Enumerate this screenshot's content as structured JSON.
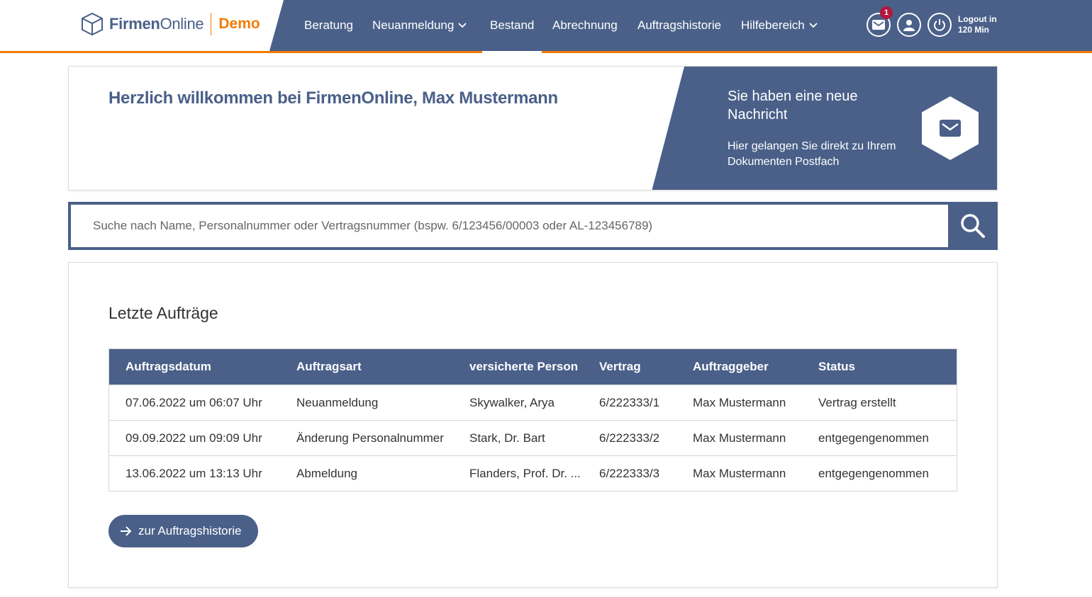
{
  "logo": {
    "part1": "Firmen",
    "part2": "Online",
    "demo": "Demo"
  },
  "nav": {
    "items": [
      {
        "label": "Beratung"
      },
      {
        "label": "Neuanmeldung"
      },
      {
        "label": "Bestand"
      },
      {
        "label": "Abrechnung"
      },
      {
        "label": "Auftragshistorie"
      },
      {
        "label": "Hilfebereich"
      }
    ]
  },
  "header": {
    "message_badge": "1",
    "logout_line1": "Logout in",
    "logout_line2": "120 Min"
  },
  "welcome": {
    "title": "Herzlich willkommen bei FirmenOnline, Max Mustermann",
    "message_title": "Sie haben eine neue Nachricht",
    "message_sub": "Hier gelangen Sie direkt zu Ihrem Dokumenten Postfach"
  },
  "search": {
    "placeholder": "Suche nach Name, Personalnummer oder Vertragsnummer (bspw. 6/123456/00003 oder AL-123456789)"
  },
  "orders": {
    "title": "Letzte Aufträge",
    "columns": [
      "Auftragsdatum",
      "Auftragsart",
      "versicherte Person",
      "Vertrag",
      "Auftraggeber",
      "Status"
    ],
    "rows": [
      [
        "07.06.2022 um 06:07 Uhr",
        "Neuanmeldung",
        "Skywalker, Arya",
        "6/222333/1",
        "Max Mustermann",
        "Vertrag erstellt"
      ],
      [
        "09.09.2022 um 09:09 Uhr",
        "Änderung Personalnummer",
        "Stark, Dr. Bart",
        "6/222333/2",
        "Max Mustermann",
        "entgegengenommen"
      ],
      [
        "13.06.2022 um 13:13 Uhr",
        "Abmeldung",
        "Flanders, Prof. Dr. ...",
        "6/222333/3",
        "Max Mustermann",
        "entgegengenommen"
      ]
    ],
    "history_button": "zur Auftragshistorie"
  },
  "colors": {
    "brand_blue": "#4a6089",
    "brand_orange": "#f07d00",
    "badge_red": "#b3163e"
  }
}
